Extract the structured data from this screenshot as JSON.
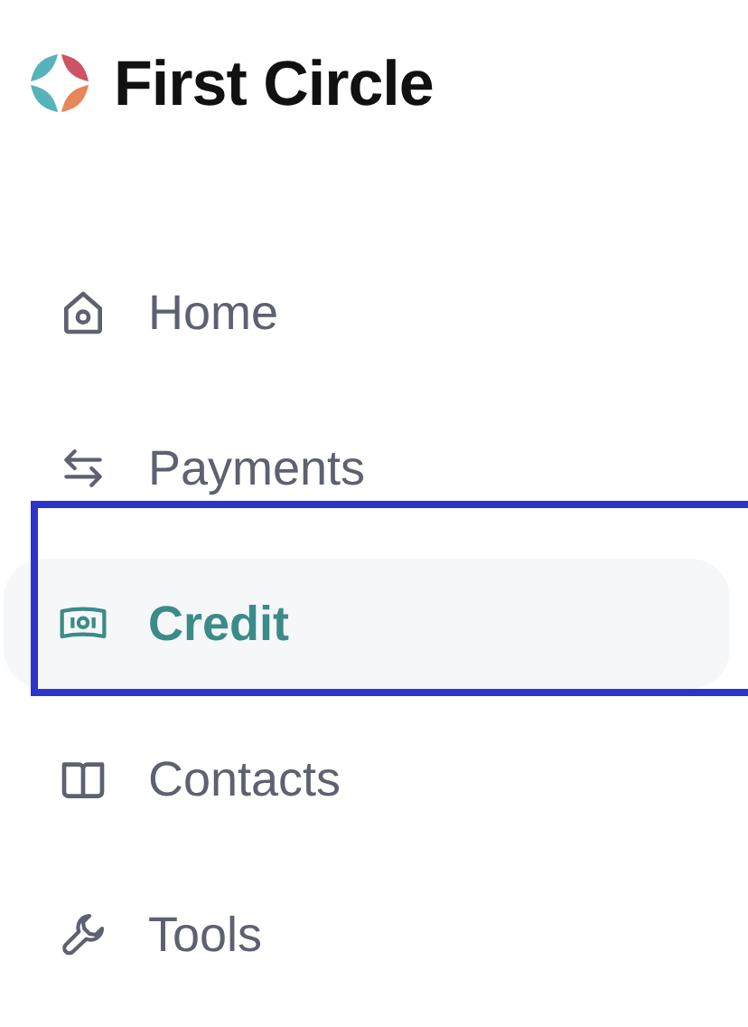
{
  "logo": {
    "text": "First Circle"
  },
  "nav": [
    {
      "label": "Home",
      "kind": "home",
      "selected": false
    },
    {
      "label": "Payments",
      "kind": "transfer",
      "selected": false
    },
    {
      "label": "Credit",
      "kind": "money",
      "selected": true
    },
    {
      "label": "Contacts",
      "kind": "book",
      "selected": false
    },
    {
      "label": "Tools",
      "kind": "wrench",
      "selected": false
    }
  ]
}
